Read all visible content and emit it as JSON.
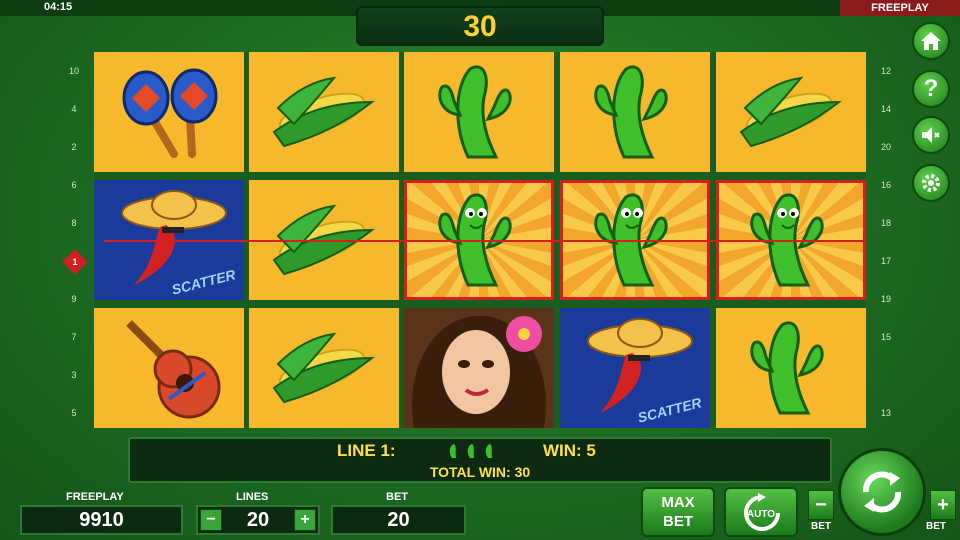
{
  "top": {
    "clock": "04:15",
    "mode": "FREEPLAY",
    "win_display": "30"
  },
  "reels": [
    [
      "maracas",
      "pepper-scatter",
      "guitar"
    ],
    [
      "corn",
      "corn",
      "corn"
    ],
    [
      "cactus",
      "cactus-smiling",
      "senorita"
    ],
    [
      "cactus",
      "cactus-smiling",
      "pepper-scatter"
    ],
    [
      "corn",
      "cactus-smiling",
      "cactus"
    ]
  ],
  "highlighted_cells": [
    "reel3-row2",
    "reel4-row2",
    "reel5-row2"
  ],
  "scatter_label": "SCATTER",
  "line_numbers_left": [
    "10",
    "4",
    "2",
    "6",
    "8",
    "9",
    "7",
    "3",
    "5"
  ],
  "active_line_marker": "1",
  "line_numbers_right": [
    "12",
    "14",
    "20",
    "16",
    "18",
    "17",
    "19",
    "15",
    "13"
  ],
  "win_info": {
    "line_label": "LINE 1:",
    "win_label": "WIN: 5",
    "total_label": "TOTAL WIN: 30"
  },
  "bottom": {
    "freeplay_label": "FREEPLAY",
    "freeplay_value": "9910",
    "lines_label": "LINES",
    "lines_value": "20",
    "lines_minus": "−",
    "lines_plus": "+",
    "bet_label": "BET",
    "bet_value": "20",
    "max_bet_line1": "MAX",
    "max_bet_line2": "BET",
    "auto_label": "AUTO",
    "bet_minus": "−",
    "bet_plus": "+",
    "bet_minus_label": "BET",
    "bet_plus_label": "BET"
  },
  "side_buttons": [
    "home-icon",
    "help-icon",
    "sound-mute-icon",
    "settings-icon"
  ],
  "colors": {
    "accent": "#ffd22b",
    "win_frame": "#d21f1f",
    "reel_bg": "#f7b92b",
    "scatter_bg": "#1a3a9c"
  }
}
